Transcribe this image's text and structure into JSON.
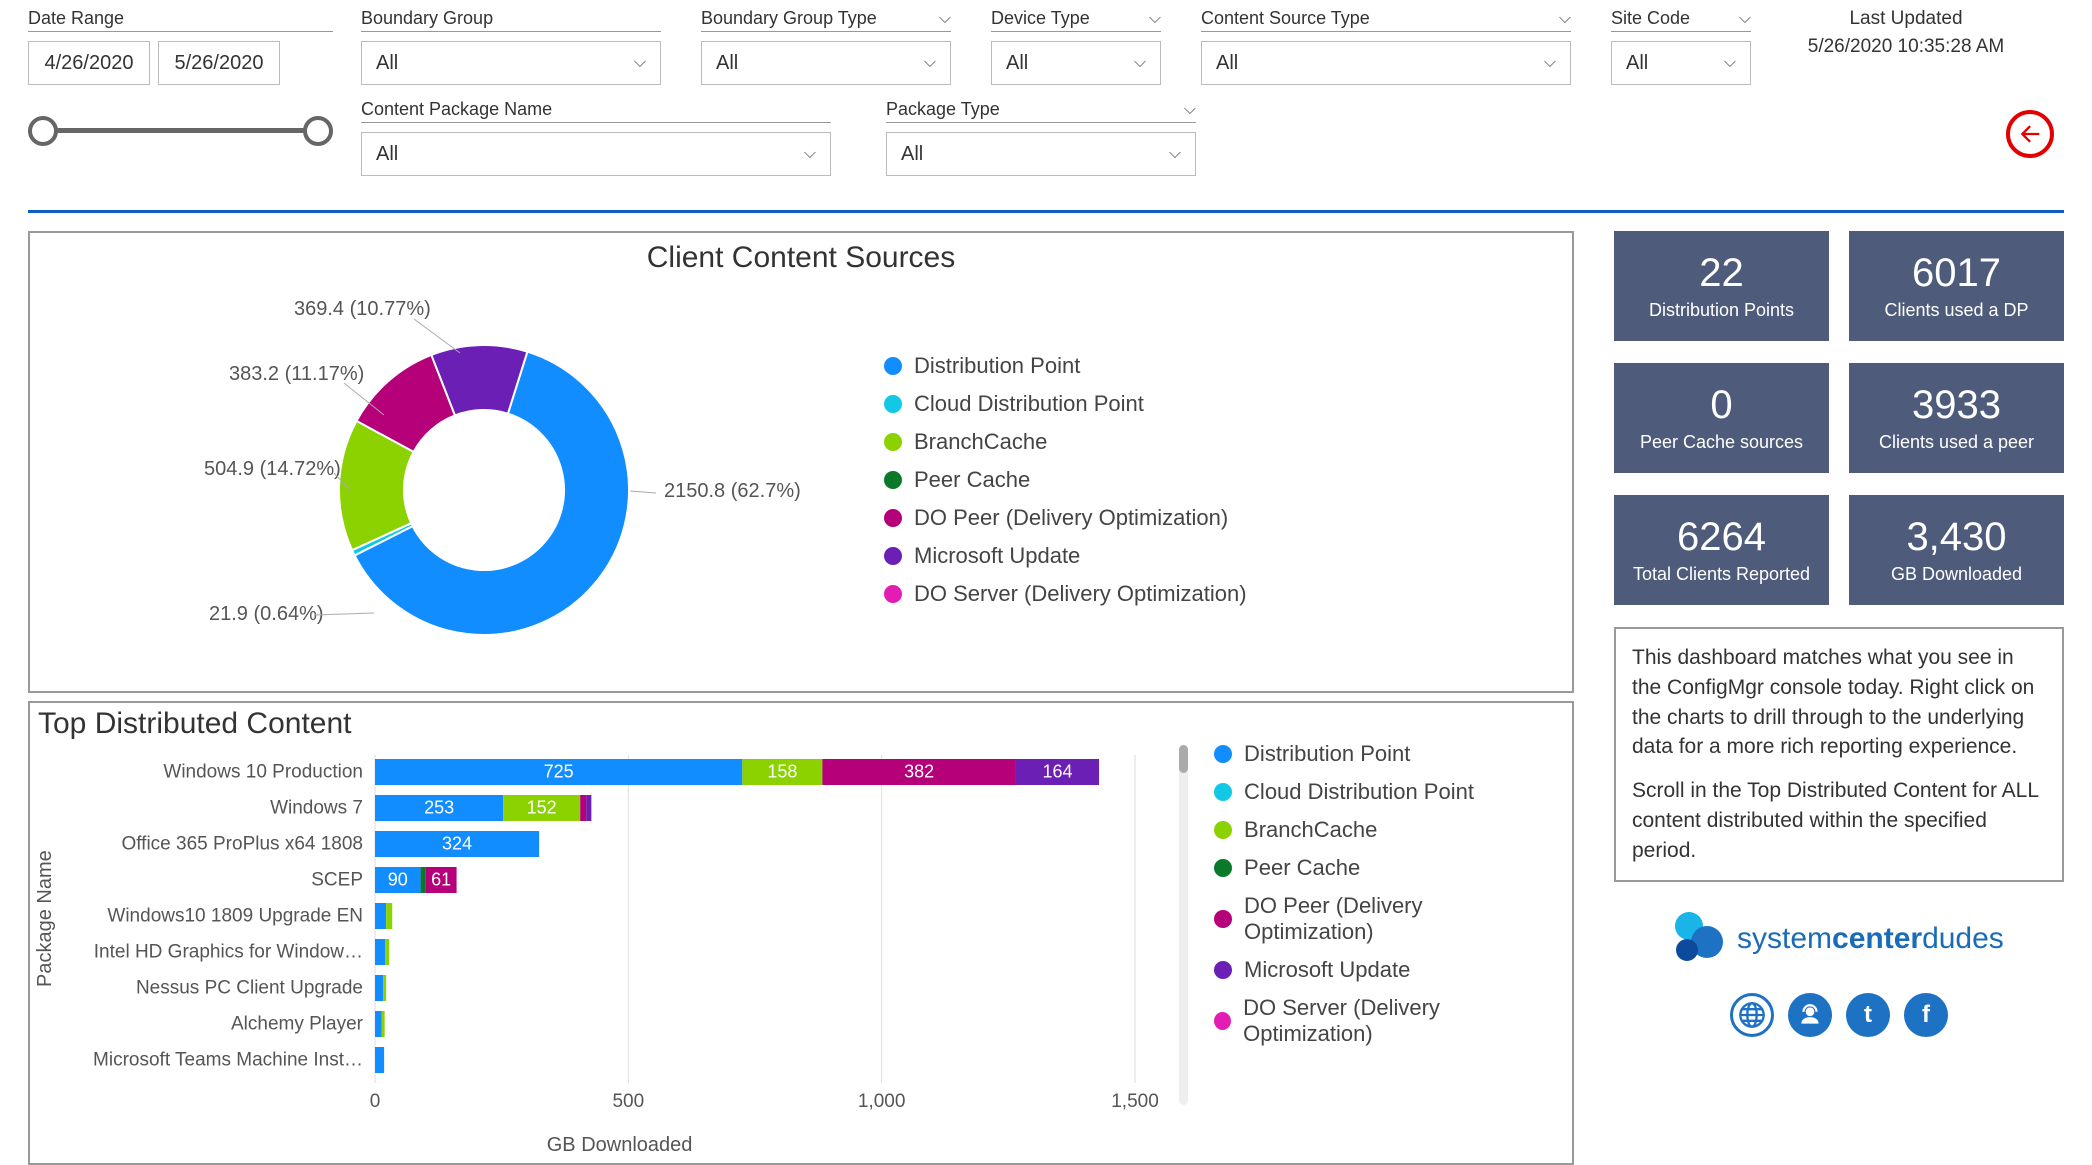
{
  "filters": {
    "date_range_label": "Date Range",
    "date_start": "4/26/2020",
    "date_end": "5/26/2020",
    "boundary_group_label": "Boundary Group",
    "boundary_group_value": "All",
    "boundary_group_type_label": "Boundary Group Type",
    "boundary_group_type_value": "All",
    "device_type_label": "Device Type",
    "device_type_value": "All",
    "content_source_type_label": "Content Source Type",
    "content_source_type_value": "All",
    "site_code_label": "Site Code",
    "site_code_value": "All",
    "content_package_name_label": "Content Package Name",
    "content_package_name_value": "All",
    "package_type_label": "Package Type",
    "package_type_value": "All"
  },
  "last_updated": {
    "label": "Last Updated",
    "value": "5/26/2020 10:35:28 AM"
  },
  "donut": {
    "title": "Client Content Sources",
    "labels": {
      "dp": "2150.8 (62.7%)",
      "cdp": "21.9 (0.64%)",
      "branch": "504.9 (14.72%)",
      "dopeer": "383.2 (11.17%)",
      "msupdate": "369.4 (10.77%)"
    }
  },
  "legend": {
    "items": [
      {
        "name": "Distribution Point",
        "color": "#118dff"
      },
      {
        "name": "Cloud Distribution Point",
        "color": "#12c9e5"
      },
      {
        "name": "BranchCache",
        "color": "#8bd200"
      },
      {
        "name": "Peer Cache",
        "color": "#0a7a2a"
      },
      {
        "name": "DO Peer (Delivery Optimization)",
        "color": "#b6007a"
      },
      {
        "name": "Microsoft Update",
        "color": "#6b1fb5"
      },
      {
        "name": "DO Server (Delivery Optimization)",
        "color": "#e31db3"
      }
    ]
  },
  "bars": {
    "title": "Top Distributed Content",
    "x_title": "GB Downloaded",
    "y_title": "Package Name",
    "x_ticks": [
      "0",
      "500",
      "1,000",
      "1,500"
    ],
    "rows": [
      {
        "name": "Windows 10 Production",
        "segs": [
          {
            "c": "#118dff",
            "v": 725,
            "lbl": "725"
          },
          {
            "c": "#8bd200",
            "v": 158,
            "lbl": "158"
          },
          {
            "c": "#b6007a",
            "v": 382,
            "lbl": "382"
          },
          {
            "c": "#6b1fb5",
            "v": 164,
            "lbl": "164"
          }
        ]
      },
      {
        "name": "Windows 7",
        "segs": [
          {
            "c": "#118dff",
            "v": 253,
            "lbl": "253"
          },
          {
            "c": "#8bd200",
            "v": 152,
            "lbl": "152"
          },
          {
            "c": "#b6007a",
            "v": 12,
            "lbl": ""
          },
          {
            "c": "#6b1fb5",
            "v": 10,
            "lbl": ""
          }
        ]
      },
      {
        "name": "Office 365 ProPlus x64 1808",
        "segs": [
          {
            "c": "#118dff",
            "v": 324,
            "lbl": "324"
          }
        ]
      },
      {
        "name": "SCEP",
        "segs": [
          {
            "c": "#118dff",
            "v": 90,
            "lbl": "90"
          },
          {
            "c": "#0a7a2a",
            "v": 10,
            "lbl": ""
          },
          {
            "c": "#b6007a",
            "v": 61,
            "lbl": "61"
          }
        ]
      },
      {
        "name": "Windows10 1809 Upgrade EN",
        "segs": [
          {
            "c": "#118dff",
            "v": 22,
            "lbl": ""
          },
          {
            "c": "#8bd200",
            "v": 12,
            "lbl": ""
          }
        ]
      },
      {
        "name": "Intel HD Graphics for Window…",
        "segs": [
          {
            "c": "#118dff",
            "v": 20,
            "lbl": ""
          },
          {
            "c": "#8bd200",
            "v": 8,
            "lbl": ""
          }
        ]
      },
      {
        "name": "Nessus PC Client Upgrade",
        "segs": [
          {
            "c": "#118dff",
            "v": 16,
            "lbl": ""
          },
          {
            "c": "#8bd200",
            "v": 6,
            "lbl": ""
          }
        ]
      },
      {
        "name": "Alchemy Player",
        "segs": [
          {
            "c": "#118dff",
            "v": 13,
            "lbl": ""
          },
          {
            "c": "#8bd200",
            "v": 6,
            "lbl": ""
          }
        ]
      },
      {
        "name": "Microsoft Teams Machine Inst…",
        "segs": [
          {
            "c": "#118dff",
            "v": 18,
            "lbl": ""
          }
        ]
      }
    ]
  },
  "kpi": {
    "r1c1_v": "22",
    "r1c1_l": "Distribution Points",
    "r1c2_v": "6017",
    "r1c2_l": "Clients used a DP",
    "r2c1_v": "0",
    "r2c1_l": "Peer Cache sources",
    "r2c2_v": "3933",
    "r2c2_l": "Clients used a peer",
    "r3c1_v": "6264",
    "r3c1_l": "Total Clients Reported",
    "r3c2_v": "3,430",
    "r3c2_l": "GB Downloaded"
  },
  "info": {
    "p1": "This dashboard matches what you see in the ConfigMgr console today. Right click on the charts to drill through to the underlying data for a more rich reporting experience.",
    "p2": "Scroll in the Top Distributed Content for ALL content distributed within the specified period."
  },
  "logo": {
    "t1": "system",
    "t2": "center",
    "t3": "dudes"
  },
  "chart_data": [
    {
      "type": "pie",
      "title": "Client Content Sources",
      "series": [
        {
          "name": "Distribution Point",
          "value": 2150.8,
          "percent": 62.7,
          "color": "#118dff"
        },
        {
          "name": "Cloud Distribution Point",
          "value": 21.9,
          "percent": 0.64,
          "color": "#12c9e5"
        },
        {
          "name": "BranchCache",
          "value": 504.9,
          "percent": 14.72,
          "color": "#8bd200"
        },
        {
          "name": "Peer Cache",
          "value": 0,
          "percent": 0,
          "color": "#0a7a2a"
        },
        {
          "name": "DO Peer (Delivery Optimization)",
          "value": 383.2,
          "percent": 11.17,
          "color": "#b6007a"
        },
        {
          "name": "Microsoft Update",
          "value": 369.4,
          "percent": 10.77,
          "color": "#6b1fb5"
        },
        {
          "name": "DO Server (Delivery Optimization)",
          "value": 0,
          "percent": 0,
          "color": "#e31db3"
        }
      ]
    },
    {
      "type": "bar",
      "title": "Top Distributed Content",
      "xlabel": "GB Downloaded",
      "ylabel": "Package Name",
      "xlim": [
        0,
        1500
      ],
      "stack_order": [
        "Distribution Point",
        "Cloud Distribution Point",
        "BranchCache",
        "Peer Cache",
        "DO Peer (Delivery Optimization)",
        "Microsoft Update",
        "DO Server (Delivery Optimization)"
      ],
      "categories": [
        "Windows 10 Production",
        "Windows 7",
        "Office 365 ProPlus x64 1808",
        "SCEP",
        "Windows10 1809 Upgrade EN",
        "Intel HD Graphics for Windows",
        "Nessus PC Client Upgrade",
        "Alchemy Player",
        "Microsoft Teams Machine Installer"
      ],
      "series": [
        {
          "name": "Distribution Point",
          "color": "#118dff",
          "values": [
            725,
            253,
            324,
            90,
            22,
            20,
            16,
            13,
            18
          ]
        },
        {
          "name": "Cloud Distribution Point",
          "color": "#12c9e5",
          "values": [
            0,
            0,
            0,
            0,
            0,
            0,
            0,
            0,
            0
          ]
        },
        {
          "name": "BranchCache",
          "color": "#8bd200",
          "values": [
            158,
            152,
            0,
            0,
            12,
            8,
            6,
            6,
            0
          ]
        },
        {
          "name": "Peer Cache",
          "color": "#0a7a2a",
          "values": [
            0,
            0,
            0,
            10,
            0,
            0,
            0,
            0,
            0
          ]
        },
        {
          "name": "DO Peer (Delivery Optimization)",
          "color": "#b6007a",
          "values": [
            382,
            12,
            0,
            61,
            0,
            0,
            0,
            0,
            0
          ]
        },
        {
          "name": "Microsoft Update",
          "color": "#6b1fb5",
          "values": [
            164,
            10,
            0,
            0,
            0,
            0,
            0,
            0,
            0
          ]
        },
        {
          "name": "DO Server (Delivery Optimization)",
          "color": "#e31db3",
          "values": [
            0,
            0,
            0,
            0,
            0,
            0,
            0,
            0,
            0
          ]
        }
      ]
    }
  ]
}
